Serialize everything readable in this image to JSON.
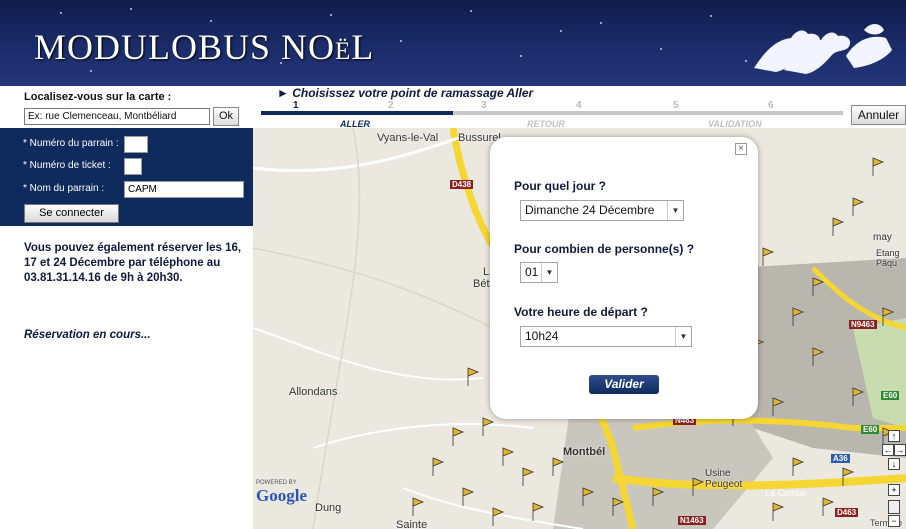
{
  "header": {
    "logo_text": "MODULOBUS NOëL",
    "logo_icon": "sleigh-horses-icon"
  },
  "locate": {
    "title": "Localisez-vous sur la carte :",
    "input_value": "Ex: rue Clemenceau, Montbéliard",
    "ok_label": "Ok"
  },
  "login": {
    "parrain_label": "* Numéro du parrain :",
    "parrain_value": "",
    "ticket_label": "* Numéro de ticket :",
    "ticket_value": "",
    "nom_label": "* Nom du parrain :",
    "nom_value": "CAPM",
    "connect_label": "Se connecter"
  },
  "info": {
    "phone_text": "Vous pouvez également réserver les 16, 17 et 24 Décembre par téléphone au 03.81.31.14.16 de 9h à 20h30.",
    "status_text": "Réservation en cours..."
  },
  "steps": {
    "title": "► Choisissez votre point de ramassage Aller",
    "numbers": [
      "1",
      "2",
      "3",
      "4",
      "5",
      "6"
    ],
    "labels": [
      "ALLER",
      "RETOUR",
      "VALIDATION"
    ],
    "annuler_label": "Annuler"
  },
  "popup": {
    "close_label": "×",
    "q_day": "Pour quel jour ?",
    "day_value": "Dimanche 24 Décembre",
    "q_people": "Pour combien de personne(s) ?",
    "people_value": "01",
    "q_time": "Votre heure de départ ?",
    "time_value": "10h24",
    "valider_label": "Valider"
  },
  "map": {
    "places": [
      "Vyans-le-Val",
      "Bussurel",
      "Allondans",
      "Montbél",
      "Usine Peugeot",
      "Dung",
      "Sainte",
      "La Combe",
      "Etang Pâqu",
      "may",
      "Bét",
      "L"
    ],
    "roads": [
      "D438",
      "N9463",
      "E60",
      "E60",
      "A36",
      "N463",
      "N1463",
      "D463"
    ],
    "powered_by": "POWERED BY",
    "google": "Google",
    "terms": "Terms o"
  }
}
